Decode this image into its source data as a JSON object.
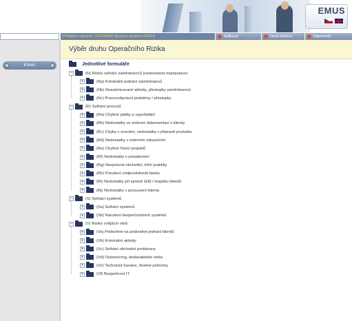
{
  "banner": {
    "logo_text": "EMUS",
    "lang_cz_icon": "flag-cz-icon",
    "lang_en_icon": "flag-uk-icon"
  },
  "status": {
    "user_line": "Přihlášen uživatel: CEN99999 Správce systému EMUS"
  },
  "menu": {
    "items": [
      "Aplikace",
      "Nové hlášení",
      "Nápověda"
    ]
  },
  "sidebar": {
    "konec_label": "Konec"
  },
  "page": {
    "title": "Výběr druhu Operačního Rizika"
  },
  "tree": {
    "root_label": "Jednotlivé formuláře",
    "groups": [
      {
        "label": "(N) Riziko selhání zaměstnanců (nedovolená manipulace)",
        "children": [
          "(Na) Kriminální jednání zaměstnanců",
          "(Nb) Neautorizované aktivity, přestupky zaměstnanců",
          "(Nc) Pracovněprávní problémy / přestupky"
        ]
      },
      {
        "label": "(R) Selhání procesů",
        "children": [
          "(Ra) Chybné platby a vypořádání",
          "(Rb) Nedostatky ve smluvní dokumentaci s klienty",
          "(Rc) Chyby v ocenění, nedostatky v přípravě produktu",
          "(Rd) Nedostatky v externím výkaznictví",
          "(Re) Chybné řízení projektů",
          "(Rf) Nedostatky v poradenství",
          "(Rg) Nesprávné obchodní, tržní praktiky",
          "(Rh) Porušení zodpovědnosti banky",
          "(Ri) Nedostatky při správě účtů / majetku klientů",
          "(Rj) Nedostatky v posouzení klienta"
        ]
      },
      {
        "label": "(S) Selhání systémů",
        "children": [
          "(Sa) Selhání systémů",
          "(Sb) Narušení bezpečnostních systémů"
        ]
      },
      {
        "label": "(V) Riziko vnějších vlivů",
        "children": [
          "(Va) Podezření na podvodné jednání klientů",
          "(Vb) Kriminální aktivity",
          "(Vc) Selhání obchodní protistrany",
          "(Vd) Outsourcing, dodavatelské riziko",
          "(Ve) Technické havárie, živelné pohromy",
          "(Vf) Bezpečnost IT"
        ]
      }
    ]
  }
}
